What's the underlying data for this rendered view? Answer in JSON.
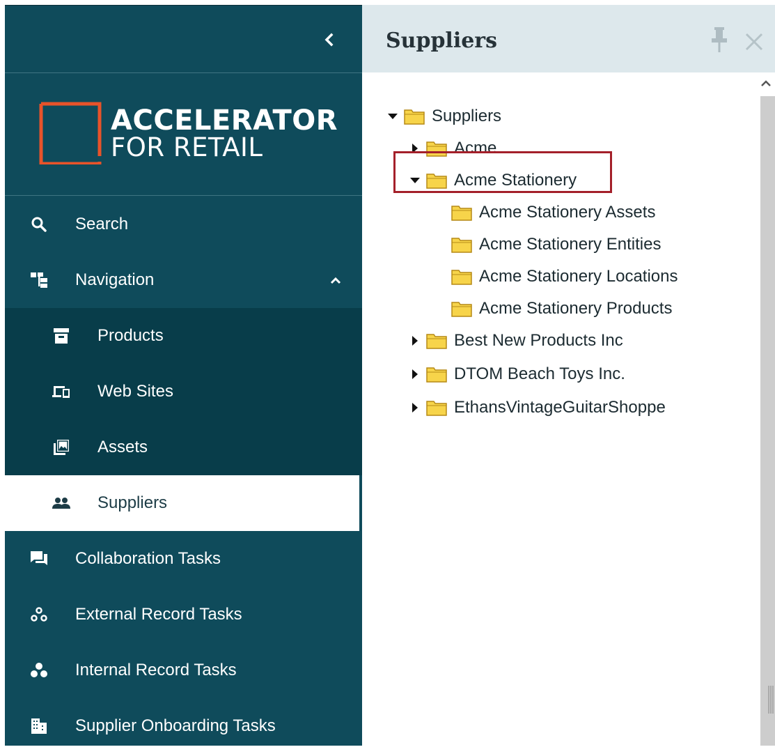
{
  "colors": {
    "sidebar_bg": "#0f4b5b",
    "sidebar_sub_bg": "#083d4a",
    "logo_accent": "#e8532a",
    "header_bg": "#dde8ec",
    "highlight_border": "#a4202a",
    "folder_fill": "#f7d44a"
  },
  "sidebar": {
    "collapse_icon": "chevron-left-icon",
    "logo": {
      "line1": "ACCELERATOR",
      "line2": "FOR RETAIL"
    },
    "items": [
      {
        "label": "Search",
        "icon": "search-icon"
      },
      {
        "label": "Navigation",
        "icon": "hierarchy-icon",
        "expanded": true
      },
      {
        "label": "Products",
        "icon": "archive-box-icon",
        "sub": true
      },
      {
        "label": "Web Sites",
        "icon": "devices-icon",
        "sub": true
      },
      {
        "label": "Assets",
        "icon": "image-icon",
        "sub": true
      },
      {
        "label": "Suppliers",
        "icon": "people-icon",
        "sub": true,
        "active": true
      },
      {
        "label": "Collaboration Tasks",
        "icon": "chat-icon"
      },
      {
        "label": "External Record Tasks",
        "icon": "circles-outline-icon"
      },
      {
        "label": "Internal Record Tasks",
        "icon": "circles-filled-icon"
      },
      {
        "label": "Supplier Onboarding Tasks",
        "icon": "building-icon"
      }
    ]
  },
  "panel": {
    "title": "Suppliers",
    "pin_icon": "pin-icon",
    "close_icon": "close-icon",
    "tree": [
      {
        "label": "Suppliers",
        "level": 0,
        "state": "expanded"
      },
      {
        "label": "Acme",
        "level": 1,
        "state": "collapsed"
      },
      {
        "label": "Acme Stationery",
        "level": 1,
        "state": "expanded",
        "highlighted": true
      },
      {
        "label": "Acme Stationery Assets",
        "level": 2,
        "state": "leaf"
      },
      {
        "label": "Acme Stationery Entities",
        "level": 2,
        "state": "leaf"
      },
      {
        "label": "Acme Stationery Locations",
        "level": 2,
        "state": "leaf"
      },
      {
        "label": "Acme Stationery Products",
        "level": 2,
        "state": "leaf"
      },
      {
        "label": "Best New Products Inc",
        "level": 1,
        "state": "collapsed"
      },
      {
        "label": "DTOM Beach Toys Inc.",
        "level": 1,
        "state": "collapsed"
      },
      {
        "label": "EthansVintageGuitarShoppe",
        "level": 1,
        "state": "collapsed"
      }
    ]
  }
}
